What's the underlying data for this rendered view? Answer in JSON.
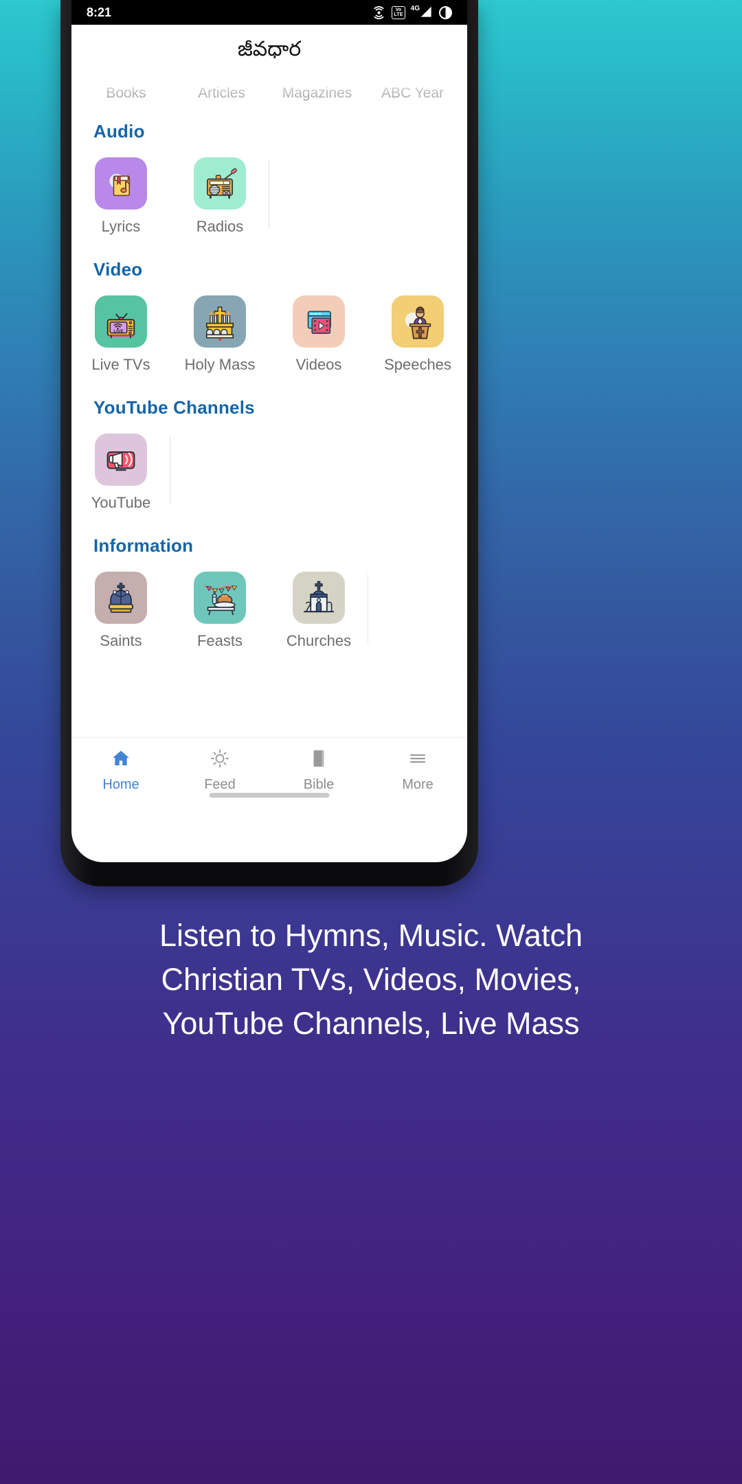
{
  "status_bar": {
    "time": "8:21",
    "icons": [
      "cast-icon",
      "volte-icon",
      "signal-4g-icon",
      "battery-icon"
    ],
    "volte_top": "Vo",
    "volte_bottom": "LTE",
    "network": "4G"
  },
  "app_bar": {
    "title": "జీవధార"
  },
  "tabs": [
    {
      "label": "Books"
    },
    {
      "label": "Articles"
    },
    {
      "label": "Magazines"
    },
    {
      "label": "ABC Year"
    }
  ],
  "sections": [
    {
      "title": "Audio",
      "tiles": [
        {
          "label": "Lyrics",
          "icon": "songbook-icon",
          "bg": "#b889e8"
        },
        {
          "label": "Radios",
          "icon": "radio-icon",
          "bg": "#9fecd0"
        }
      ]
    },
    {
      "title": "Video",
      "tiles": [
        {
          "label": "Live TVs",
          "icon": "live-tv-icon",
          "bg": "#56c4a0"
        },
        {
          "label": "Holy Mass",
          "icon": "altar-icon",
          "bg": "#86a6b3"
        },
        {
          "label": "Videos",
          "icon": "video-player-icon",
          "bg": "#f4cdb8"
        },
        {
          "label": "Speeches",
          "icon": "speaker-podium-icon",
          "bg": "#f2ce74"
        }
      ]
    },
    {
      "title": "YouTube Channels",
      "tiles": [
        {
          "label": "YouTube",
          "icon": "youtube-megaphone-icon",
          "bg": "#ddc6db"
        }
      ]
    },
    {
      "title": "Information",
      "tiles": [
        {
          "label": "Saints",
          "icon": "crown-icon",
          "bg": "#c5aeae"
        },
        {
          "label": "Feasts",
          "icon": "feast-table-icon",
          "bg": "#6fc7bb"
        },
        {
          "label": "Churches",
          "icon": "church-icon",
          "bg": "#d5d4c4"
        }
      ]
    }
  ],
  "bottom_nav": [
    {
      "label": "Home",
      "icon": "home-icon",
      "active": true
    },
    {
      "label": "Feed",
      "icon": "sun-icon",
      "active": false
    },
    {
      "label": "Bible",
      "icon": "book-icon",
      "active": false
    },
    {
      "label": "More",
      "icon": "menu-icon",
      "active": false
    }
  ],
  "caption": {
    "line1": "Listen to Hymns, Music. Watch",
    "line2": "Christian TVs, Videos, Movies,",
    "line3": "YouTube Channels, Live Mass"
  },
  "colors": {
    "accent_blue": "#1565a6",
    "nav_active": "#4285d6",
    "label_gray": "#6d6d6d"
  }
}
